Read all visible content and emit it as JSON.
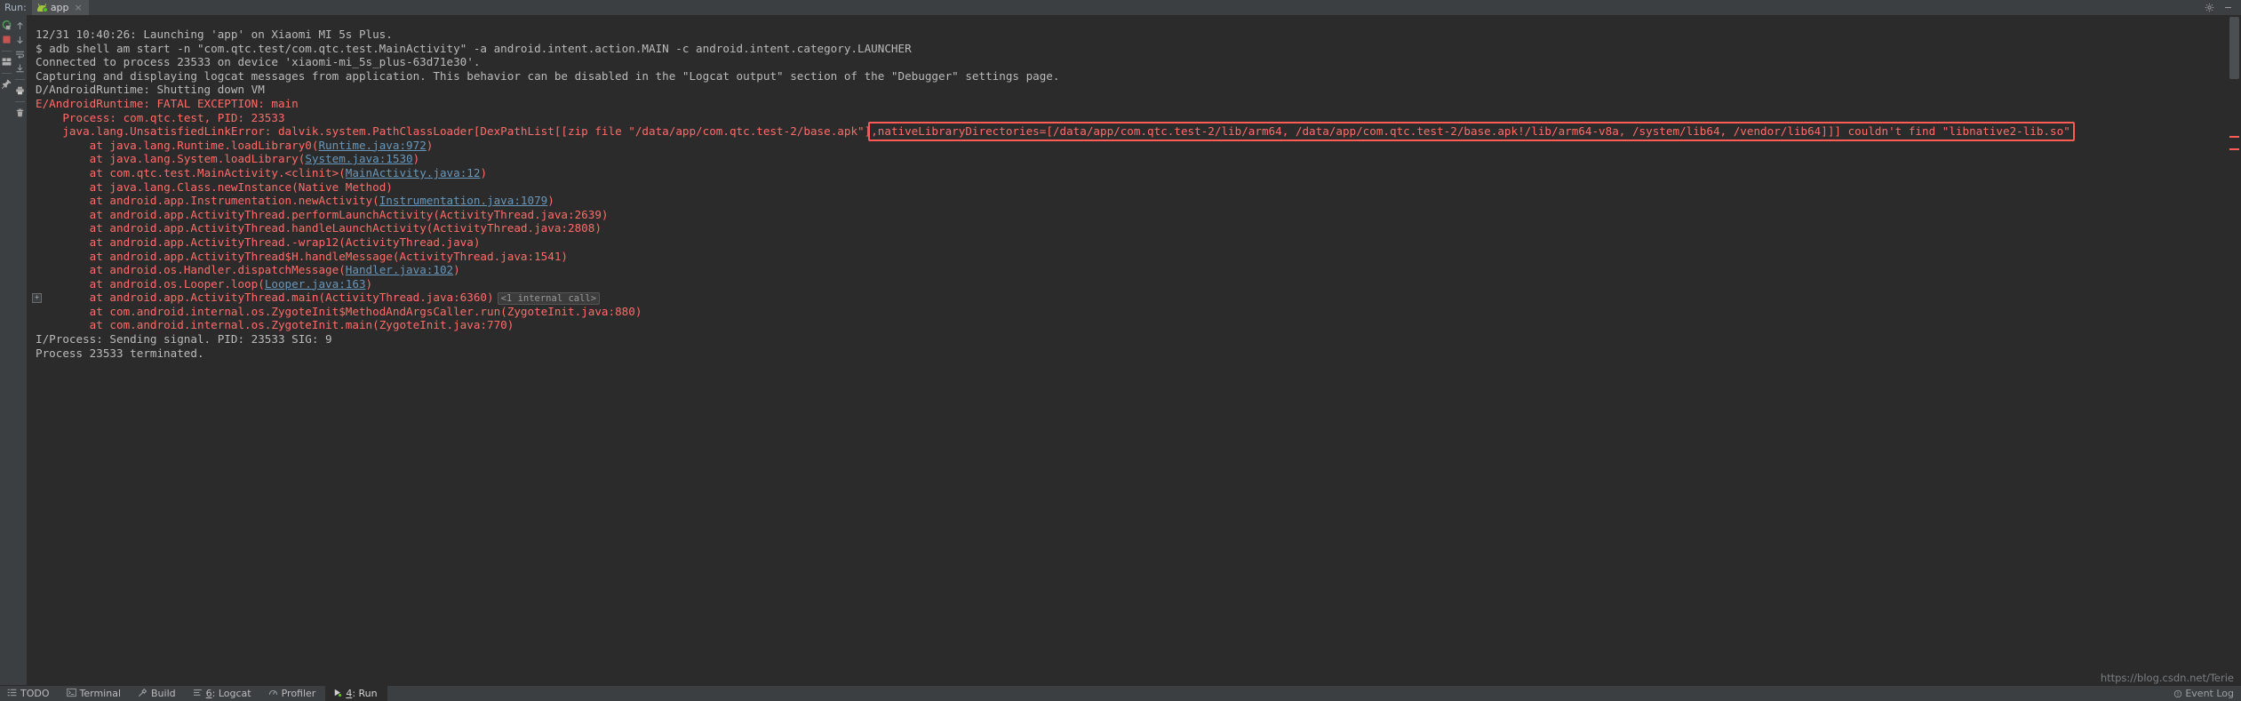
{
  "window": {
    "run_label": "Run:",
    "tab_label": "app",
    "tab_close": "×",
    "tab_icon": "android-robot-icon",
    "settings_icon": "gear-icon",
    "minimize_icon": "minimize-icon"
  },
  "toolbar": {
    "primary": [
      {
        "name": "rerun-button",
        "icon": "rerun-arrow-icon",
        "label": "Rerun"
      },
      {
        "name": "stop-button",
        "icon": "stop-square-icon",
        "label": "Stop"
      },
      {
        "name": "layout-button",
        "icon": "layout-icon",
        "label": "Layout Settings"
      },
      {
        "name": "pin-button",
        "icon": "pin-icon",
        "label": "Pin Tab"
      }
    ],
    "secondary": [
      {
        "name": "up-button",
        "icon": "arrow-up-icon",
        "label": "Up the Stack Trace"
      },
      {
        "name": "down-button",
        "icon": "arrow-down-icon",
        "label": "Down the Stack Trace"
      },
      {
        "name": "soft-wrap-button",
        "icon": "soft-wrap-icon",
        "label": "Soft-Wrap"
      },
      {
        "name": "scroll-end-button",
        "icon": "scroll-to-end-icon",
        "label": "Scroll to End"
      },
      {
        "name": "print-button",
        "icon": "printer-icon",
        "label": "Print"
      },
      {
        "name": "clear-button",
        "icon": "trash-icon",
        "label": "Clear All"
      }
    ]
  },
  "console": {
    "fold_marker": "+",
    "lines": [
      {
        "type": "info",
        "indent": 0,
        "parts": [
          {
            "t": "12/31 10:40:26: Launching 'app' on Xiaomi MI 5s Plus."
          }
        ]
      },
      {
        "type": "info",
        "indent": 0,
        "parts": [
          {
            "t": "$ adb shell am start -n \"com.qtc.test/com.qtc.test.MainActivity\" -a android.intent.action.MAIN -c android.intent.category.LAUNCHER"
          }
        ]
      },
      {
        "type": "info",
        "indent": 0,
        "parts": [
          {
            "t": "Connected to process 23533 on device 'xiaomi-mi_5s_plus-63d71e30'."
          }
        ]
      },
      {
        "type": "info",
        "indent": 0,
        "parts": [
          {
            "t": "Capturing and displaying logcat messages from application. This behavior can be disabled in the \"Logcat output\" section of the \"Debugger\" settings page."
          }
        ]
      },
      {
        "type": "info",
        "indent": 0,
        "parts": [
          {
            "t": "D/AndroidRuntime: Shutting down VM"
          }
        ]
      },
      {
        "type": "err",
        "indent": 0,
        "parts": [
          {
            "t": "E/AndroidRuntime: FATAL EXCEPTION: main"
          }
        ]
      },
      {
        "type": "err",
        "indent": 1,
        "parts": [
          {
            "t": "Process: com.qtc.test, PID: 23533"
          }
        ]
      },
      {
        "type": "err",
        "indent": 1,
        "parts": [
          {
            "t": "java.lang.UnsatisfiedLinkError: dalvik.system.PathClassLoader[DexPathList[[zip file \"/data/app/com.qtc.test-2/base.apk\"],nativeLibraryDirectories=[/data/app/com.qtc.test-2/lib/arm64, /data/app/com.qtc.test-2/base.apk!/lib/arm64-v8a, /system/lib64, /vendor/lib64]]] couldn't find \"libnative2-lib.so\""
          }
        ]
      },
      {
        "type": "err",
        "indent": 2,
        "parts": [
          {
            "t": "at java.lang.Runtime.loadLibrary0("
          },
          {
            "t": "Runtime.java:972",
            "link": true
          },
          {
            "t": ")"
          }
        ]
      },
      {
        "type": "err",
        "indent": 2,
        "parts": [
          {
            "t": "at java.lang.System.loadLibrary("
          },
          {
            "t": "System.java:1530",
            "link": true
          },
          {
            "t": ")"
          }
        ]
      },
      {
        "type": "err",
        "indent": 2,
        "parts": [
          {
            "t": "at com.qtc.test.MainActivity.<clinit>("
          },
          {
            "t": "MainActivity.java:12",
            "link": true
          },
          {
            "t": ")"
          }
        ]
      },
      {
        "type": "err",
        "indent": 2,
        "parts": [
          {
            "t": "at java.lang.Class.newInstance(Native Method)"
          }
        ]
      },
      {
        "type": "err",
        "indent": 2,
        "parts": [
          {
            "t": "at android.app.Instrumentation.newActivity("
          },
          {
            "t": "Instrumentation.java:1079",
            "link": true
          },
          {
            "t": ")"
          }
        ]
      },
      {
        "type": "err",
        "indent": 2,
        "parts": [
          {
            "t": "at android.app.ActivityThread.performLaunchActivity(ActivityThread.java:2639)"
          }
        ]
      },
      {
        "type": "err",
        "indent": 2,
        "parts": [
          {
            "t": "at android.app.ActivityThread.handleLaunchActivity(ActivityThread.java:2808)"
          }
        ]
      },
      {
        "type": "err",
        "indent": 2,
        "parts": [
          {
            "t": "at android.app.ActivityThread.-wrap12(ActivityThread.java)"
          }
        ]
      },
      {
        "type": "err",
        "indent": 2,
        "parts": [
          {
            "t": "at android.app.ActivityThread$H.handleMessage(ActivityThread.java:1541)"
          }
        ]
      },
      {
        "type": "err",
        "indent": 2,
        "parts": [
          {
            "t": "at android.os.Handler.dispatchMessage("
          },
          {
            "t": "Handler.java:102",
            "link": true
          },
          {
            "t": ")"
          }
        ]
      },
      {
        "type": "err",
        "indent": 2,
        "parts": [
          {
            "t": "at android.os.Looper.loop("
          },
          {
            "t": "Looper.java:163",
            "link": true
          },
          {
            "t": ")"
          }
        ]
      },
      {
        "type": "err",
        "indent": 2,
        "fold": true,
        "parts": [
          {
            "t": "at android.app.ActivityThread.main(ActivityThread.java:6360)"
          },
          {
            "t": "<1 internal call>",
            "folded": true
          }
        ]
      },
      {
        "type": "err",
        "indent": 2,
        "parts": [
          {
            "t": "at com.android.internal.os.ZygoteInit$MethodAndArgsCaller.run(ZygoteInit.java:880)"
          }
        ]
      },
      {
        "type": "err",
        "indent": 2,
        "parts": [
          {
            "t": "at com.android.internal.os.ZygoteInit.main(ZygoteInit.java:770)"
          }
        ]
      },
      {
        "type": "info",
        "indent": 0,
        "parts": [
          {
            "t": "I/Process: Sending signal. PID: 23533 SIG: 9"
          }
        ]
      },
      {
        "type": "info",
        "indent": 0,
        "parts": [
          {
            "t": "Process 23533 terminated."
          }
        ]
      }
    ],
    "highlight": {
      "name": "native-library-directories-highlight",
      "text": ",nativeLibraryDirectories=[/data/app/com.qtc.test-2/lib/arm64, /data/app/com.qtc.test-2/base.apk!/lib/arm64-v8a, /system/lib64, /vendor/lib64]]] couldn't find \"libnative2-lib.so\"",
      "color": "#ff5c57"
    }
  },
  "statusbar": {
    "items": [
      {
        "name": "sb-todo",
        "label": "TODO",
        "icon": "list-icon",
        "active": false
      },
      {
        "name": "sb-terminal",
        "label": "Terminal",
        "icon": "terminal-icon",
        "active": false
      },
      {
        "name": "sb-build",
        "label": "Build",
        "icon": "hammer-icon",
        "active": false
      },
      {
        "name": "sb-logcat",
        "label": "6: Logcat",
        "mnemonic": "6",
        "icon": "logcat-icon",
        "active": false
      },
      {
        "name": "sb-profiler",
        "label": "Profiler",
        "icon": "gauge-icon",
        "active": false
      },
      {
        "name": "sb-run",
        "label": "4: Run",
        "mnemonic": "4",
        "icon": "play-icon",
        "active": true
      }
    ],
    "event_log": "Event Log"
  },
  "watermark": "https://blog.csdn.net/Terie",
  "colors": {
    "background": "#2b2b2b",
    "chrome": "#3c3f41",
    "error": "#ff6b68",
    "link": "#6897bb",
    "text": "#bbbbbb",
    "accent": "#a4c639"
  }
}
